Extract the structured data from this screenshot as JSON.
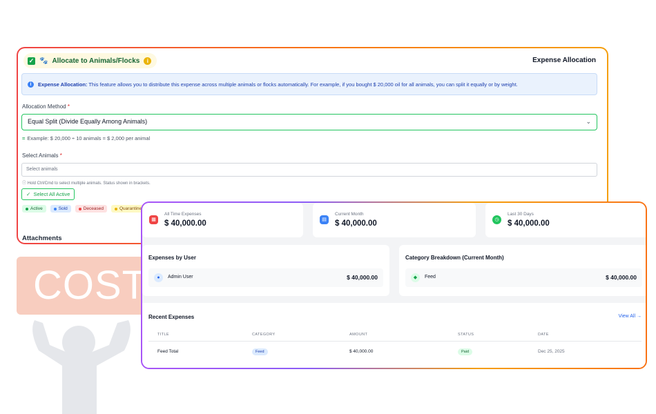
{
  "background": {
    "banner_text": "COST"
  },
  "allocation": {
    "toggle_label": "Allocate to Animals/Flocks",
    "title": "Expense Allocation",
    "info_bold": "Expense Allocation:",
    "info_text": " This feature allows you to distribute this expense across multiple animals or flocks automatically. For example, if you bought $ 20,000 oil for all animals, you can split it equally or by weight.",
    "method_label": "Allocation Method",
    "method_value": "Equal Split (Divide Equally Among Animals)",
    "example_text": "Example: $ 20,000 ÷ 10 animals = $ 2,000 per animal",
    "animals_label": "Select Animals",
    "animals_placeholder": "Select animals",
    "animals_hint": "Hold Ctrl/Cmd to select multiple animals. Status shown in brackets.",
    "select_all_label": "Select All Active",
    "status_legend": [
      {
        "label": "Active",
        "color": "#16a34a",
        "bg": "#dcfce7",
        "fg": "#166534"
      },
      {
        "label": "Sold",
        "color": "#3b82f6",
        "bg": "#dbeafe",
        "fg": "#1e40af"
      },
      {
        "label": "Deceased",
        "color": "#ef4444",
        "bg": "#fee2e2",
        "fg": "#991b1b"
      },
      {
        "label": "Quarantine",
        "color": "#eab308",
        "bg": "#fef9c3",
        "fg": "#854d0e"
      }
    ],
    "attachments_label": "Attachments"
  },
  "dashboard": {
    "stats": [
      {
        "label": "All Time Expenses",
        "value": "$ 40,000.00",
        "icon": "calendar-icon",
        "color": "#ef4444"
      },
      {
        "label": "Current Month",
        "value": "$ 40,000.00",
        "icon": "calendar-month-icon",
        "color": "#3b82f6"
      },
      {
        "label": "Last 30 Days",
        "value": "$ 40,000.00",
        "icon": "clock-icon",
        "color": "#22c55e"
      }
    ],
    "by_user": {
      "title": "Expenses by User",
      "user": "Admin User",
      "amount": "$ 40,000.00"
    },
    "category": {
      "title": "Category Breakdown (Current Month)",
      "name": "Feed",
      "amount": "$ 40,000.00"
    },
    "recent": {
      "title": "Recent Expenses",
      "view_all": "View All →",
      "columns": [
        "TITLE",
        "CATEGORY",
        "AMOUNT",
        "STATUS",
        "DATE"
      ],
      "rows": [
        {
          "title": "Feed Total",
          "category": "Feed",
          "amount": "$ 40,000.00",
          "status": "Paid",
          "date": "Dec 25, 2025"
        }
      ]
    }
  }
}
